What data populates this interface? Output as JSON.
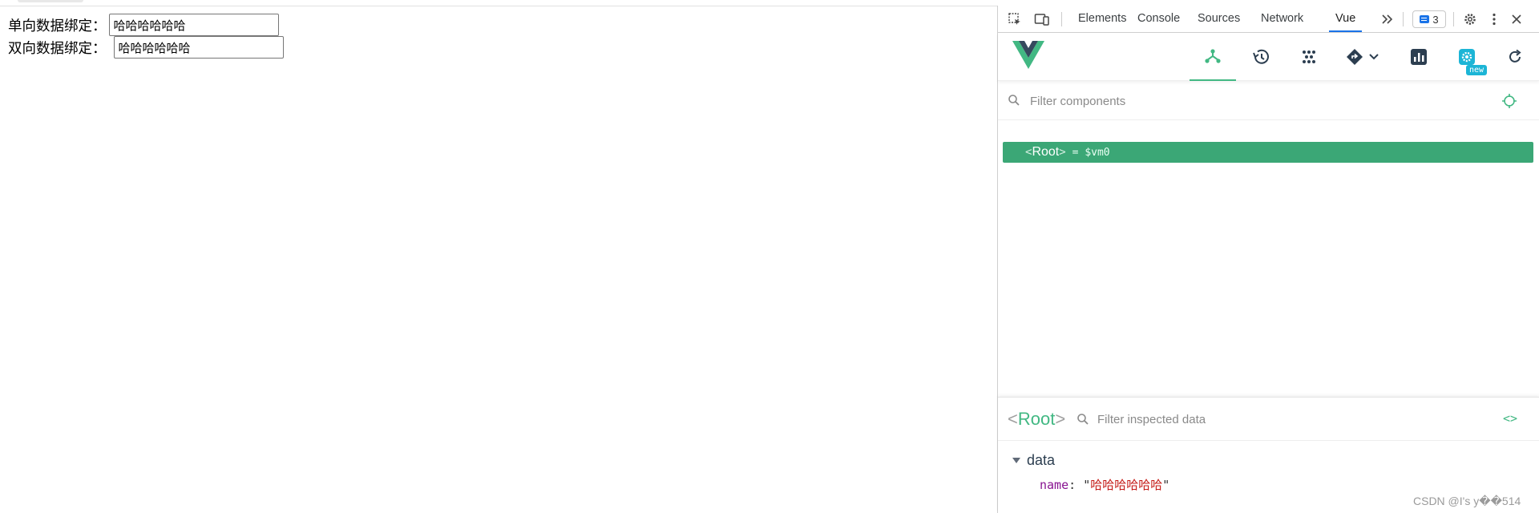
{
  "page": {
    "one_way_label": "单向数据绑定：",
    "one_way_value": "哈哈哈哈哈哈",
    "two_way_label": "双向数据绑定：",
    "two_way_value": "哈哈哈哈哈哈"
  },
  "devtools": {
    "tabs": [
      {
        "label": "Elements",
        "active": false
      },
      {
        "label": "Console",
        "active": false
      },
      {
        "label": "Sources",
        "active": false
      },
      {
        "label": "Network",
        "active": false
      },
      {
        "label": "Vue",
        "active": true
      }
    ],
    "more_tabs_icon": "chevron-double-right-icon",
    "issues_count": "3",
    "toolbar_icons": [
      "inspect-element-icon",
      "device-toggle-icon",
      "settings-gear-icon",
      "kebab-menu-icon",
      "close-icon"
    ]
  },
  "vue": {
    "nav_icons": [
      "components-icon",
      "timeline-icon",
      "pinia-icon",
      "router-icon",
      "performance-icon",
      "settings-icon",
      "refresh-icon"
    ],
    "new_badge": "new",
    "filter_placeholder": "Filter components",
    "tree": {
      "open_bracket": "<",
      "name": "Root",
      "close_bracket": ">",
      "vm": "= $vm0"
    },
    "inspector": {
      "open_bracket": "<",
      "name": "Root",
      "close_bracket": ">",
      "filter_placeholder": "Filter inspected data",
      "section": "data",
      "prop_key": "name",
      "prop_value": "哈哈哈哈哈哈"
    },
    "accent_color": "#42b883"
  },
  "watermark": "CSDN @I's y��514"
}
